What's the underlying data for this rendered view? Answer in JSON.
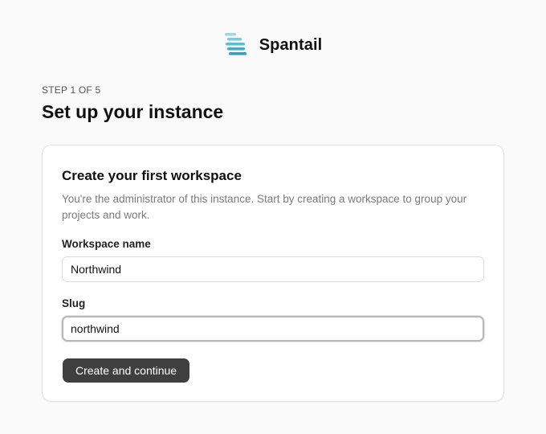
{
  "brand": {
    "name": "Spantail",
    "logo_icon": "spantail-logo-icon",
    "logo_colors": [
      "#7dd3e8",
      "#5cc4dc",
      "#2fa8c7"
    ]
  },
  "step": {
    "label": "STEP 1 OF 5"
  },
  "page": {
    "title": "Set up your instance"
  },
  "card": {
    "title": "Create your first workspace",
    "description": "You're the administrator of this instance. Start by creating a workspace to group your projects and work.",
    "fields": {
      "workspace_name": {
        "label": "Workspace name",
        "value": "Northwind"
      },
      "slug": {
        "label": "Slug",
        "value": "northwind",
        "focused": true
      }
    },
    "submit_label": "Create and continue"
  }
}
